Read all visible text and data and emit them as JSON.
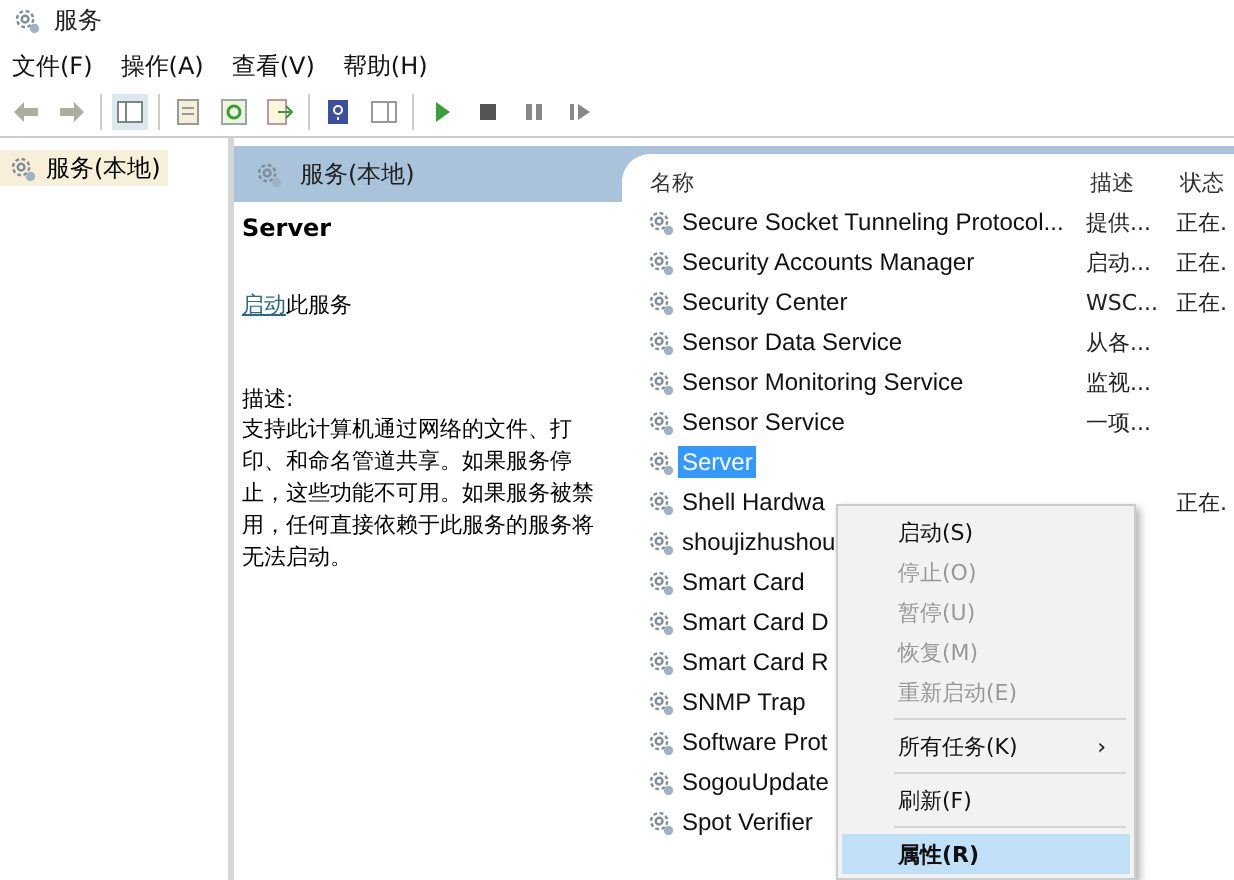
{
  "window": {
    "title": "服务"
  },
  "menu": [
    "文件(F)",
    "操作(A)",
    "查看(V)",
    "帮助(H)"
  ],
  "tree": [
    {
      "label": "服务(本地)",
      "selected": true
    }
  ],
  "pane_header": {
    "title": "服务(本地)"
  },
  "details": {
    "service_name": "Server",
    "action": {
      "link": "启动",
      "text": "此服务"
    },
    "description_label": "描述:",
    "description": "支持此计算机通过网络的文件、打印、和命名管道共享。如果服务停止，这些功能不可用。如果服务被禁用，任何直接依赖于此服务的服务将无法启动。"
  },
  "table": {
    "columns": [
      "名称",
      "描述",
      "状态"
    ],
    "rows": [
      {
        "name": "Secure Socket Tunneling Protocol...",
        "description": "提供...",
        "status": "正在.",
        "selected": false
      },
      {
        "name": "Security Accounts Manager",
        "description": "启动...",
        "status": "正在.",
        "selected": false
      },
      {
        "name": "Security Center",
        "description": "WSC...",
        "status": "正在.",
        "selected": false
      },
      {
        "name": "Sensor Data Service",
        "description": "从各...",
        "selected": false
      },
      {
        "name": "Sensor Monitoring Service",
        "description": "监视...",
        "selected": false
      },
      {
        "name": "Sensor Service",
        "description": "一项...",
        "selected": false
      },
      {
        "name": "Server",
        "selected": true
      },
      {
        "name": "Shell Hardwa",
        "status": "正在.",
        "selected": false
      },
      {
        "name": "shoujizhushou",
        "selected": false
      },
      {
        "name": "Smart Card",
        "selected": false
      },
      {
        "name": "Smart Card D",
        "selected": false
      },
      {
        "name": "Smart Card R",
        "selected": false
      },
      {
        "name": "SNMP Trap",
        "selected": false
      },
      {
        "name": "Software Prot",
        "selected": false
      },
      {
        "name": "SogouUpdate",
        "selected": false
      },
      {
        "name": "Spot Verifier",
        "selected": false
      }
    ]
  },
  "context_menu": [
    {
      "kind": "item",
      "label": "启动(S)",
      "disabled": false,
      "selected": false
    },
    {
      "kind": "item",
      "label": "停止(O)",
      "disabled": true,
      "selected": false
    },
    {
      "kind": "item",
      "label": "暂停(U)",
      "disabled": true,
      "selected": false
    },
    {
      "kind": "item",
      "label": "恢复(M)",
      "disabled": true,
      "selected": false
    },
    {
      "kind": "item",
      "label": "重新启动(E)",
      "disabled": true,
      "selected": false
    },
    {
      "kind": "separator"
    },
    {
      "kind": "submenu",
      "label": "所有任务(K)",
      "arrow": "›",
      "disabled": false,
      "selected": false
    },
    {
      "kind": "separator"
    },
    {
      "kind": "item",
      "label": "刷新(F)",
      "disabled": false,
      "selected": false
    },
    {
      "kind": "separator"
    },
    {
      "kind": "item",
      "label": "属性(R)",
      "disabled": false,
      "selected": true
    }
  ]
}
